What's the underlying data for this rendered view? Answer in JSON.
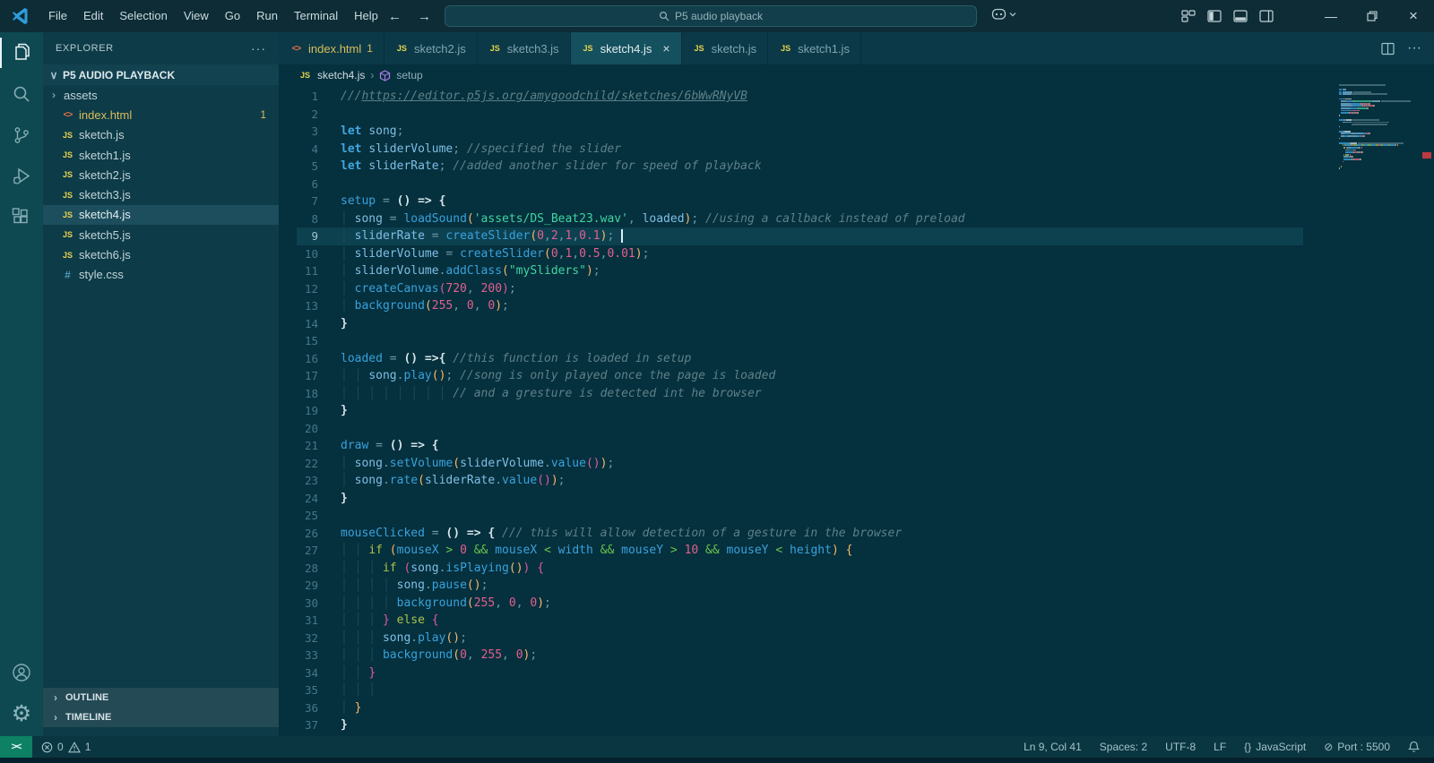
{
  "titlebar": {
    "menus": [
      "File",
      "Edit",
      "Selection",
      "View",
      "Go",
      "Run",
      "Terminal",
      "Help"
    ],
    "search": "P5 audio playback",
    "back_arrow": "←",
    "forward_arrow": "→",
    "minimize": "—",
    "close": "×"
  },
  "tabs": [
    {
      "label": "index.html",
      "icon": "html",
      "badge": "1",
      "active": false,
      "modified": true
    },
    {
      "label": "sketch2.js",
      "icon": "js",
      "active": false
    },
    {
      "label": "sketch3.js",
      "icon": "js",
      "active": false
    },
    {
      "label": "sketch4.js",
      "icon": "js",
      "active": true,
      "close": "×"
    },
    {
      "label": "sketch.js",
      "icon": "js",
      "active": false
    },
    {
      "label": "sketch1.js",
      "icon": "js",
      "active": false
    }
  ],
  "tab_actions": {
    "more": "···"
  },
  "explorer": {
    "title": "EXPLORER",
    "more": "···",
    "root": "P5 AUDIO PLAYBACK",
    "root_chevron": "∨",
    "items": [
      {
        "name": "assets",
        "kind": "folder",
        "chevron": "›"
      },
      {
        "name": "index.html",
        "kind": "html",
        "badge": "1",
        "modified": true
      },
      {
        "name": "sketch.js",
        "kind": "js"
      },
      {
        "name": "sketch1.js",
        "kind": "js"
      },
      {
        "name": "sketch2.js",
        "kind": "js"
      },
      {
        "name": "sketch3.js",
        "kind": "js"
      },
      {
        "name": "sketch4.js",
        "kind": "js",
        "selected": true
      },
      {
        "name": "sketch5.js",
        "kind": "js"
      },
      {
        "name": "sketch6.js",
        "kind": "js"
      },
      {
        "name": "style.css",
        "kind": "css"
      }
    ],
    "sections": [
      {
        "label": "OUTLINE",
        "chevron": "›"
      },
      {
        "label": "TIMELINE",
        "chevron": "›"
      }
    ]
  },
  "breadcrumb": {
    "file": "sketch4.js",
    "separator": "›",
    "symbol": "setup"
  },
  "statusbar": {
    "problems": {
      "errors": "0",
      "warnings": "1"
    },
    "right": [
      {
        "label": "Ln 9, Col 41"
      },
      {
        "label": "Spaces: 2"
      },
      {
        "label": "UTF-8"
      },
      {
        "label": "LF"
      },
      {
        "label": "JavaScript",
        "icon": "braces",
        "icon_glyph": "{}"
      },
      {
        "label": "Port : 5500",
        "icon": "slash-circle",
        "icon_glyph": "⊘"
      },
      {
        "label": "",
        "icon": "bell"
      }
    ]
  },
  "colors": {
    "accent_modified": "#d9bd5a",
    "remote_bg": "#0e8064",
    "editor_bg": "#05303d",
    "sidebar_bg": "#0d3b48",
    "statusbar_bg": "#0a3641",
    "warning_marker": "#bc3a40"
  },
  "code": {
    "lines": [
      {
        "n": 1,
        "t": [
          [
            "cmt",
            "///"
          ],
          [
            "lnk",
            "https://editor.p5js.org/amygoodchild/sketches/6bWwRNyVB"
          ]
        ]
      },
      {
        "n": 2,
        "t": []
      },
      {
        "n": 3,
        "t": [
          [
            "kw",
            "let"
          ],
          [
            "txt",
            " "
          ],
          [
            "var",
            "song"
          ],
          [
            "pun",
            ";"
          ]
        ]
      },
      {
        "n": 4,
        "t": [
          [
            "kw",
            "let"
          ],
          [
            "txt",
            " "
          ],
          [
            "var",
            "sliderVolume"
          ],
          [
            "pun",
            ";"
          ],
          [
            "txt",
            " "
          ],
          [
            "cmt",
            "//specified the slider"
          ]
        ]
      },
      {
        "n": 5,
        "t": [
          [
            "kw",
            "let"
          ],
          [
            "txt",
            " "
          ],
          [
            "var",
            "sliderRate"
          ],
          [
            "pun",
            ";"
          ],
          [
            "txt",
            " "
          ],
          [
            "cmt",
            "//added another slider for speed of playback"
          ]
        ]
      },
      {
        "n": 6,
        "t": []
      },
      {
        "n": 7,
        "t": [
          [
            "fn",
            "setup"
          ],
          [
            "pun",
            " = "
          ],
          [
            "b1",
            "()"
          ],
          [
            "arr",
            " => "
          ],
          [
            "b1",
            "{"
          ]
        ]
      },
      {
        "n": 8,
        "t": [
          [
            "gd",
            "│ "
          ],
          [
            "var",
            "song"
          ],
          [
            "pun",
            " = "
          ],
          [
            "fn",
            "loadSound"
          ],
          [
            "b2",
            "("
          ],
          [
            "str",
            "'assets/DS_Beat23.wav'"
          ],
          [
            "pun",
            ", "
          ],
          [
            "var",
            "loaded"
          ],
          [
            "b2",
            ")"
          ],
          [
            "pun",
            ";"
          ],
          [
            "txt",
            " "
          ],
          [
            "cmt",
            "//using a callback instead of preload"
          ]
        ]
      },
      {
        "n": 9,
        "active": true,
        "cursor": true,
        "t": [
          [
            "gd",
            "│ "
          ],
          [
            "var",
            "sliderRate"
          ],
          [
            "pun",
            " = "
          ],
          [
            "fn",
            "createSlider"
          ],
          [
            "b2",
            "("
          ],
          [
            "num",
            "0"
          ],
          [
            "pun",
            ","
          ],
          [
            "num",
            "2"
          ],
          [
            "pun",
            ","
          ],
          [
            "num",
            "1"
          ],
          [
            "pun",
            ","
          ],
          [
            "num",
            "0.1"
          ],
          [
            "b2",
            ")"
          ],
          [
            "pun",
            ";"
          ],
          [
            "txt",
            " "
          ]
        ]
      },
      {
        "n": 10,
        "t": [
          [
            "gd",
            "│ "
          ],
          [
            "var",
            "sliderVolume"
          ],
          [
            "pun",
            " = "
          ],
          [
            "fn",
            "createSlider"
          ],
          [
            "b2",
            "("
          ],
          [
            "num",
            "0"
          ],
          [
            "pun",
            ","
          ],
          [
            "num",
            "1"
          ],
          [
            "pun",
            ","
          ],
          [
            "num",
            "0.5"
          ],
          [
            "pun",
            ","
          ],
          [
            "num",
            "0.01"
          ],
          [
            "b2",
            ")"
          ],
          [
            "pun",
            ";"
          ]
        ]
      },
      {
        "n": 11,
        "t": [
          [
            "gd",
            "│ "
          ],
          [
            "var",
            "sliderVolume"
          ],
          [
            "pun",
            "."
          ],
          [
            "fn",
            "addClass"
          ],
          [
            "b2",
            "("
          ],
          [
            "str",
            "\"mySliders\""
          ],
          [
            "b2",
            ")"
          ],
          [
            "pun",
            ";"
          ]
        ]
      },
      {
        "n": 12,
        "t": [
          [
            "gd",
            "│ "
          ],
          [
            "fn",
            "createCanvas"
          ],
          [
            "b3",
            "("
          ],
          [
            "num",
            "720"
          ],
          [
            "pun",
            ", "
          ],
          [
            "num",
            "200"
          ],
          [
            "b3",
            ")"
          ],
          [
            "pun",
            ";"
          ]
        ]
      },
      {
        "n": 13,
        "t": [
          [
            "gd",
            "│ "
          ],
          [
            "fn",
            "background"
          ],
          [
            "b2",
            "("
          ],
          [
            "num",
            "255"
          ],
          [
            "pun",
            ", "
          ],
          [
            "num",
            "0"
          ],
          [
            "pun",
            ", "
          ],
          [
            "num",
            "0"
          ],
          [
            "b2",
            ")"
          ],
          [
            "pun",
            ";"
          ]
        ]
      },
      {
        "n": 14,
        "t": [
          [
            "b1",
            "}"
          ]
        ]
      },
      {
        "n": 15,
        "t": []
      },
      {
        "n": 16,
        "t": [
          [
            "fn",
            "loaded"
          ],
          [
            "pun",
            " = "
          ],
          [
            "b1",
            "()"
          ],
          [
            "arr",
            " =>"
          ],
          [
            "b1",
            "{"
          ],
          [
            "txt",
            " "
          ],
          [
            "cmt",
            "//this function is loaded in setup"
          ]
        ]
      },
      {
        "n": 17,
        "t": [
          [
            "gd",
            "│ │ "
          ],
          [
            "var",
            "song"
          ],
          [
            "pun",
            "."
          ],
          [
            "fn",
            "play"
          ],
          [
            "b2",
            "()"
          ],
          [
            "pun",
            ";"
          ],
          [
            "txt",
            " "
          ],
          [
            "cmt",
            "//song is only played once the page is loaded"
          ]
        ]
      },
      {
        "n": 18,
        "t": [
          [
            "gd",
            "│ │ │ │ │ │ │ │ "
          ],
          [
            "cmt",
            "// and a gresture is detected int he browser"
          ]
        ]
      },
      {
        "n": 19,
        "t": [
          [
            "b1",
            "}"
          ]
        ]
      },
      {
        "n": 20,
        "t": []
      },
      {
        "n": 21,
        "t": [
          [
            "fn",
            "draw"
          ],
          [
            "pun",
            " = "
          ],
          [
            "b1",
            "()"
          ],
          [
            "arr",
            " => "
          ],
          [
            "b1",
            "{"
          ]
        ]
      },
      {
        "n": 22,
        "t": [
          [
            "gd",
            "│ "
          ],
          [
            "var",
            "song"
          ],
          [
            "pun",
            "."
          ],
          [
            "fn",
            "setVolume"
          ],
          [
            "b2",
            "("
          ],
          [
            "var",
            "sliderVolume"
          ],
          [
            "pun",
            "."
          ],
          [
            "fn",
            "value"
          ],
          [
            "b3",
            "()"
          ],
          [
            "b2",
            ")"
          ],
          [
            "pun",
            ";"
          ]
        ]
      },
      {
        "n": 23,
        "t": [
          [
            "gd",
            "│ "
          ],
          [
            "var",
            "song"
          ],
          [
            "pun",
            "."
          ],
          [
            "fn",
            "rate"
          ],
          [
            "b2",
            "("
          ],
          [
            "var",
            "sliderRate"
          ],
          [
            "pun",
            "."
          ],
          [
            "fn",
            "value"
          ],
          [
            "b3",
            "()"
          ],
          [
            "b2",
            ")"
          ],
          [
            "pun",
            ";"
          ]
        ]
      },
      {
        "n": 24,
        "t": [
          [
            "b1",
            "}"
          ]
        ]
      },
      {
        "n": 25,
        "t": []
      },
      {
        "n": 26,
        "t": [
          [
            "fn",
            "mouseClicked"
          ],
          [
            "pun",
            " = "
          ],
          [
            "b1",
            "()"
          ],
          [
            "arr",
            " => "
          ],
          [
            "b1",
            "{"
          ],
          [
            "txt",
            " "
          ],
          [
            "cmt",
            "/// this will allow detection of a gesture in the browser"
          ]
        ]
      },
      {
        "n": 27,
        "t": [
          [
            "gd",
            "│ │ "
          ],
          [
            "kwc",
            "if"
          ],
          [
            "txt",
            " "
          ],
          [
            "b2",
            "("
          ],
          [
            "fn",
            "mouseX"
          ],
          [
            "op",
            " > "
          ],
          [
            "num",
            "0"
          ],
          [
            "op",
            " && "
          ],
          [
            "fn",
            "mouseX"
          ],
          [
            "op",
            " < "
          ],
          [
            "fn",
            "width"
          ],
          [
            "op",
            " && "
          ],
          [
            "fn",
            "mouseY"
          ],
          [
            "op",
            " > "
          ],
          [
            "num",
            "10"
          ],
          [
            "op",
            " && "
          ],
          [
            "fn",
            "mouseY"
          ],
          [
            "op",
            " < "
          ],
          [
            "fn",
            "height"
          ],
          [
            "b2",
            ")"
          ],
          [
            "txt",
            " "
          ],
          [
            "b2",
            "{"
          ]
        ]
      },
      {
        "n": 28,
        "t": [
          [
            "gd",
            "│ │ │ "
          ],
          [
            "kwc",
            "if"
          ],
          [
            "txt",
            " "
          ],
          [
            "b3",
            "("
          ],
          [
            "var",
            "song"
          ],
          [
            "pun",
            "."
          ],
          [
            "fn",
            "isPlaying"
          ],
          [
            "b2",
            "()"
          ],
          [
            "b3",
            ")"
          ],
          [
            "txt",
            " "
          ],
          [
            "b3",
            "{"
          ]
        ]
      },
      {
        "n": 29,
        "t": [
          [
            "gd",
            "│ │ │ │ "
          ],
          [
            "var",
            "song"
          ],
          [
            "pun",
            "."
          ],
          [
            "fn",
            "pause"
          ],
          [
            "b2",
            "()"
          ],
          [
            "pun",
            ";"
          ]
        ]
      },
      {
        "n": 30,
        "t": [
          [
            "gd",
            "│ │ │ │ "
          ],
          [
            "fn",
            "background"
          ],
          [
            "b2",
            "("
          ],
          [
            "num",
            "255"
          ],
          [
            "pun",
            ", "
          ],
          [
            "num",
            "0"
          ],
          [
            "pun",
            ", "
          ],
          [
            "num",
            "0"
          ],
          [
            "b2",
            ")"
          ],
          [
            "pun",
            ";"
          ]
        ]
      },
      {
        "n": 31,
        "t": [
          [
            "gd",
            "│ │ │ "
          ],
          [
            "b3",
            "}"
          ],
          [
            "txt",
            " "
          ],
          [
            "kwc",
            "else"
          ],
          [
            "txt",
            " "
          ],
          [
            "b3",
            "{"
          ]
        ]
      },
      {
        "n": 32,
        "t": [
          [
            "gd",
            "│ │ │ "
          ],
          [
            "var",
            "song"
          ],
          [
            "pun",
            "."
          ],
          [
            "fn",
            "play"
          ],
          [
            "b2",
            "()"
          ],
          [
            "pun",
            ";"
          ]
        ]
      },
      {
        "n": 33,
        "t": [
          [
            "gd",
            "│ │ │ "
          ],
          [
            "fn",
            "background"
          ],
          [
            "b2",
            "("
          ],
          [
            "num",
            "0"
          ],
          [
            "pun",
            ", "
          ],
          [
            "num",
            "255"
          ],
          [
            "pun",
            ", "
          ],
          [
            "num",
            "0"
          ],
          [
            "b2",
            ")"
          ],
          [
            "pun",
            ";"
          ]
        ]
      },
      {
        "n": 34,
        "t": [
          [
            "gd",
            "│ │ "
          ],
          [
            "b3",
            "}"
          ]
        ]
      },
      {
        "n": 35,
        "t": [
          [
            "gd",
            "│ │ │"
          ]
        ]
      },
      {
        "n": 36,
        "t": [
          [
            "gd",
            "│ "
          ],
          [
            "b2",
            "}"
          ]
        ]
      },
      {
        "n": 37,
        "t": [
          [
            "b1",
            "}"
          ]
        ]
      }
    ]
  }
}
